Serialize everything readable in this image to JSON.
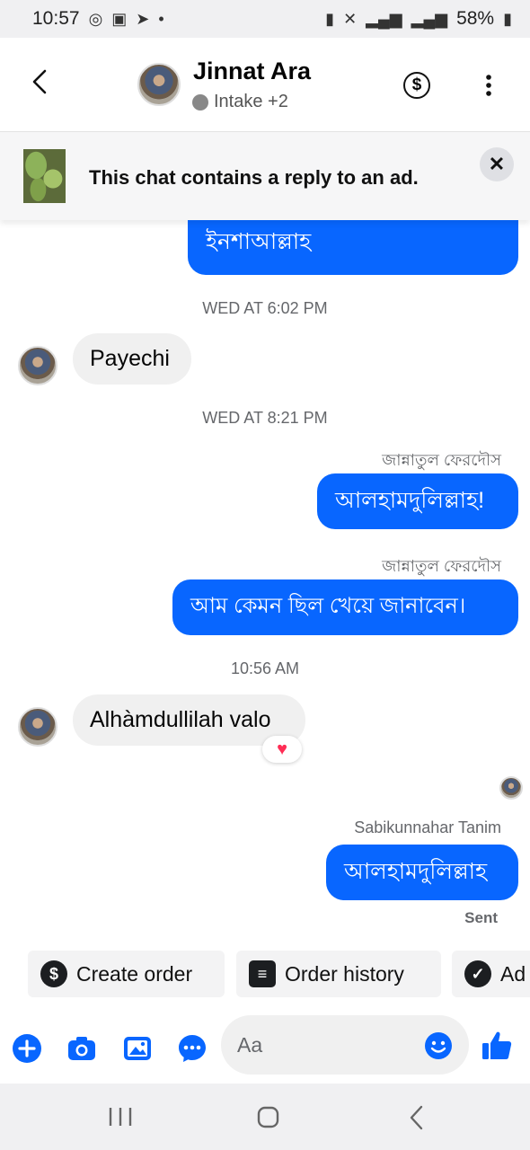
{
  "status_bar": {
    "time": "10:57",
    "battery": "58%"
  },
  "header": {
    "title": "Jinnat Ara",
    "subtitle": "Intake +2"
  },
  "ad_banner": {
    "text": "This chat contains a reply to an ad."
  },
  "messages": {
    "partial_out_text": "ইনশাআল্লাহ",
    "ts1": "WED AT 6:02 PM",
    "in1": "Payechi",
    "ts2": "WED AT 8:21 PM",
    "sender1": "জান্নাতুল ফেরদৌস",
    "out1": "আলহামদুলিল্লাহ!",
    "sender2": "জান্নাতুল ফেরদৌস",
    "out2": "আম কেমন ছিল খেয়ে জানাবেন।",
    "ts3": "10:56 AM",
    "in2": "Alhàmdullilah valo",
    "reaction": "♥",
    "sender3": "Sabikunnahar Tanim",
    "out3": "আলহামদুলিল্লাহ",
    "status": "Sent"
  },
  "chips": [
    {
      "label": "Create order",
      "icon": "dollar-circle-icon"
    },
    {
      "label": "Order history",
      "icon": "list-icon"
    },
    {
      "label": "Ad",
      "icon": "check-circle-icon"
    }
  ],
  "composer": {
    "placeholder": "Aa"
  },
  "colors": {
    "accent": "#0866ff",
    "bubble_in": "#f0f0f0",
    "banner_bg": "#f6f6f7"
  }
}
